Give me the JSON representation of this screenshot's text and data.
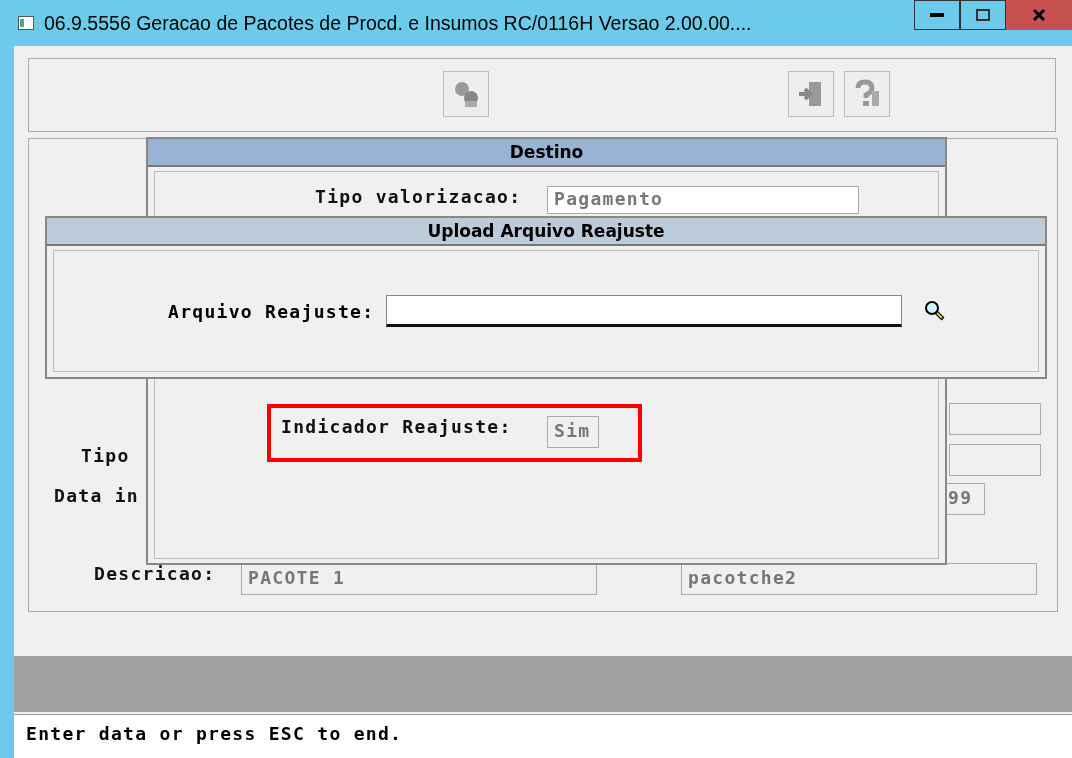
{
  "window": {
    "title": "06.9.5556 Geracao de Pacotes de Procd. e Insumos RC/0116H Versao 2.00.00...."
  },
  "toolbar": {
    "buttons": [
      {
        "kind": "process"
      },
      {
        "kind": "exit"
      },
      {
        "kind": "help"
      }
    ]
  },
  "background_form": {
    "tipo_label": "Tipo",
    "data_label": "Data in",
    "date_value": "99",
    "descricao_label": "Descricao:",
    "descricao_value": "PACOTE 1",
    "descricao_value_2": "pacotche2"
  },
  "destino_dialog": {
    "title": "Destino",
    "tipo_valorizacao_label": "Tipo valorizacao:",
    "tipo_valorizacao_value": "Pagamento",
    "indicador_label": "Indicador Reajuste:",
    "indicador_value": "Sim",
    "highlighted": true
  },
  "upload_dialog": {
    "title": "Upload Arquivo Reajuste",
    "field_label": "Arquivo Reajuste:"
  },
  "status_bar": {
    "text": "Enter data or press ESC to end."
  }
}
